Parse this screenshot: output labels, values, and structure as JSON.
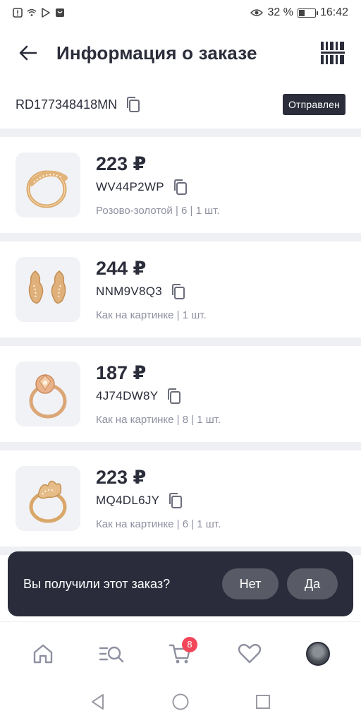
{
  "status_bar": {
    "battery_percent": "32 %",
    "battery_level": 0.32,
    "time": "16:42"
  },
  "header": {
    "title": "Информация о заказе"
  },
  "order": {
    "id": "RD177348418MN",
    "status": "Отправлен"
  },
  "items": [
    {
      "price": "223 ₽",
      "sku": "WV44P2WP",
      "details": "Розово-золотой | 6 | 1 шт."
    },
    {
      "price": "244 ₽",
      "sku": "NNM9V8Q3",
      "details": "Как на картинке | 1 шт."
    },
    {
      "price": "187 ₽",
      "sku": "4J74DW8Y",
      "details": "Как на картинке | 8 | 1 шт."
    },
    {
      "price": "223 ₽",
      "sku": "MQ4DL6JY",
      "details": "Как на картинке | 6 | 1 шт."
    }
  ],
  "prompt": {
    "question": "Вы получили этот заказ?",
    "no_label": "Нет",
    "yes_label": "Да"
  },
  "bottom_nav": {
    "cart_count": "8"
  },
  "colors": {
    "primary": "#2b2d3a",
    "muted": "#8e90a0",
    "badge": "#f2475a",
    "divider": "#eef0f4"
  }
}
